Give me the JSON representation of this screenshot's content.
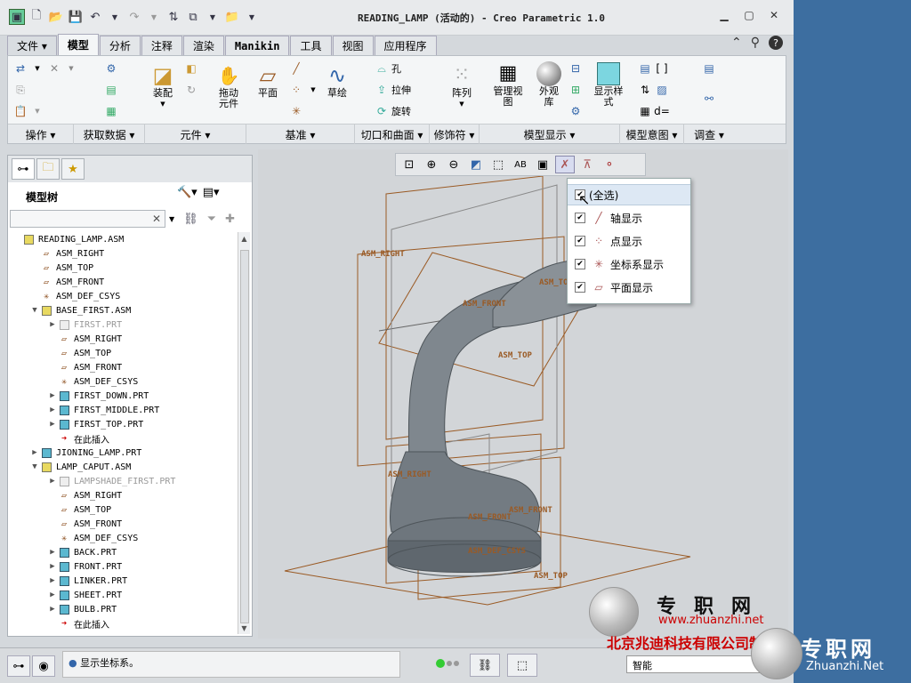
{
  "window": {
    "title": "READING_LAMP (活动的) - Creo Parametric 1.0"
  },
  "ribbon_tabs": [
    "文件 ▾",
    "模型",
    "分析",
    "注释",
    "渲染",
    "Manikin",
    "工具",
    "视图",
    "应用程序"
  ],
  "ribbon": {
    "buttons": {
      "assemble": "装配",
      "drag": "拖动\n元件",
      "plane": "平面",
      "sketch": "草绘",
      "hole": "孔",
      "extrude": "拉伸",
      "revolve": "旋转",
      "pattern": "阵列",
      "manage_views": "管理视\n图",
      "appearance": "外观\n库",
      "display_style": "显示样\n式"
    },
    "groups": [
      "操作 ▾",
      "获取数据 ▾",
      "元件 ▾",
      "基准 ▾",
      "切口和曲面 ▾",
      "修饰符 ▾",
      "模型显示 ▾",
      "模型意图 ▾",
      "调查 ▾"
    ]
  },
  "model_tree": {
    "header": "模型树",
    "items": [
      {
        "label": "READING_LAMP.ASM",
        "type": "asm",
        "level": 0
      },
      {
        "label": "ASM_RIGHT",
        "type": "plane",
        "level": 1
      },
      {
        "label": "ASM_TOP",
        "type": "plane",
        "level": 1
      },
      {
        "label": "ASM_FRONT",
        "type": "plane",
        "level": 1
      },
      {
        "label": "ASM_DEF_CSYS",
        "type": "csys",
        "level": 1
      },
      {
        "label": "BASE_FIRST.ASM",
        "type": "asm",
        "level": 1
      },
      {
        "label": "FIRST.PRT",
        "type": "grey",
        "level": 2
      },
      {
        "label": "ASM_RIGHT",
        "type": "plane",
        "level": 2
      },
      {
        "label": "ASM_TOP",
        "type": "plane",
        "level": 2
      },
      {
        "label": "ASM_FRONT",
        "type": "plane",
        "level": 2
      },
      {
        "label": "ASM_DEF_CSYS",
        "type": "csys",
        "level": 2
      },
      {
        "label": "FIRST_DOWN.PRT",
        "type": "part",
        "level": 2
      },
      {
        "label": "FIRST_MIDDLE.PRT",
        "type": "part",
        "level": 2
      },
      {
        "label": "FIRST_TOP.PRT",
        "type": "part",
        "level": 2
      },
      {
        "label": "在此插入",
        "type": "insert",
        "level": 2
      },
      {
        "label": "JIONING_LAMP.PRT",
        "type": "part",
        "level": 1
      },
      {
        "label": "LAMP_CAPUT.ASM",
        "type": "asm",
        "level": 1
      },
      {
        "label": "LAMPSHADE_FIRST.PRT",
        "type": "grey",
        "level": 2
      },
      {
        "label": "ASM_RIGHT",
        "type": "plane",
        "level": 2
      },
      {
        "label": "ASM_TOP",
        "type": "plane",
        "level": 2
      },
      {
        "label": "ASM_FRONT",
        "type": "plane",
        "level": 2
      },
      {
        "label": "ASM_DEF_CSYS",
        "type": "csys",
        "level": 2
      },
      {
        "label": "BACK.PRT",
        "type": "part",
        "level": 2
      },
      {
        "label": "FRONT.PRT",
        "type": "part",
        "level": 2
      },
      {
        "label": "LINKER.PRT",
        "type": "part",
        "level": 2
      },
      {
        "label": "SHEET.PRT",
        "type": "part",
        "level": 2
      },
      {
        "label": "BULB.PRT",
        "type": "part",
        "level": 2
      },
      {
        "label": "在此插入",
        "type": "insert",
        "level": 2
      }
    ]
  },
  "datum_dropdown": {
    "items": [
      {
        "label": "(全选)",
        "checked": true
      },
      {
        "label": "轴显示",
        "checked": true
      },
      {
        "label": "点显示",
        "checked": true
      },
      {
        "label": "坐标系显示",
        "checked": true
      },
      {
        "label": "平面显示",
        "checked": true
      }
    ]
  },
  "viewport_labels": {
    "asm_right_top": "ASM_RIGHT",
    "asm_front_top": "ASM_FRONT",
    "asm_top_top": "ASM_TOP",
    "asm_top_top2": "ASM_TOP",
    "asm_right_bottom": "ASM_RIGHT",
    "asm_front_bottom": "ASM_FRONT",
    "asm_front_bottom2": "ASM_FRONT",
    "asm_def_csys": "ASM_DEF_CSYS",
    "asm_top_bottom": "ASM_TOP"
  },
  "status": {
    "message": "显示坐标系。",
    "filter_value": "智能"
  },
  "watermark": {
    "brand": "专职网",
    "url": "www.zhuanzhi.net",
    "company": "北京兆迪科技有限公司制作",
    "brand2": "专职网",
    "url2": "Zhuanzhi.Net"
  },
  "colors": {
    "datum_plane": "#9a5a24",
    "desktop": "#3d6ea0",
    "part_icon": "#5bb8d0",
    "asm_icon": "#e8d960"
  }
}
